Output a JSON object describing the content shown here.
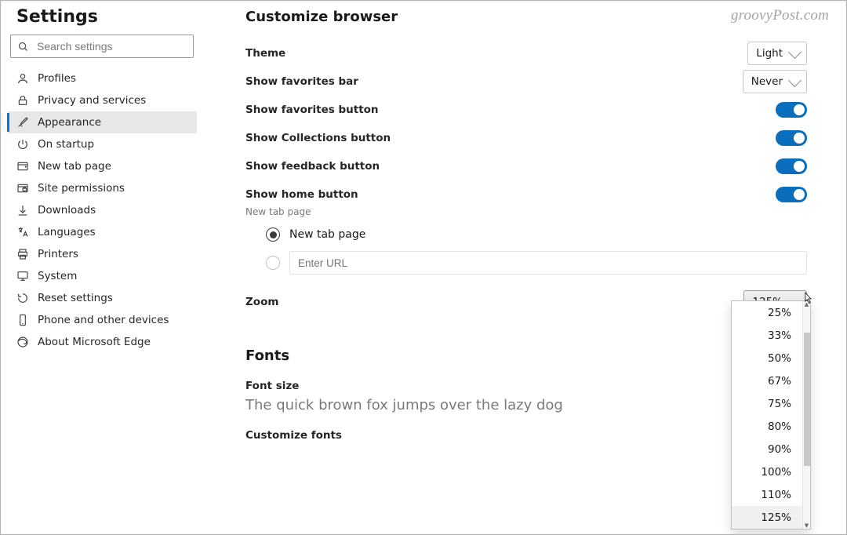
{
  "watermark": "groovyPost.com",
  "sidebar": {
    "title": "Settings",
    "search_placeholder": "Search settings",
    "items": [
      {
        "icon": "profile-icon",
        "label": "Profiles"
      },
      {
        "icon": "lock-icon",
        "label": "Privacy and services"
      },
      {
        "icon": "paint-icon",
        "label": "Appearance",
        "active": true
      },
      {
        "icon": "power-icon",
        "label": "On startup"
      },
      {
        "icon": "newtab-icon",
        "label": "New tab page"
      },
      {
        "icon": "perm-icon",
        "label": "Site permissions"
      },
      {
        "icon": "download-icon",
        "label": "Downloads"
      },
      {
        "icon": "lang-icon",
        "label": "Languages"
      },
      {
        "icon": "printer-icon",
        "label": "Printers"
      },
      {
        "icon": "system-icon",
        "label": "System"
      },
      {
        "icon": "reset-icon",
        "label": "Reset settings"
      },
      {
        "icon": "phone-icon",
        "label": "Phone and other devices"
      },
      {
        "icon": "edge-icon",
        "label": "About Microsoft Edge"
      }
    ]
  },
  "main": {
    "header": "Customize browser",
    "theme": {
      "label": "Theme",
      "value": "Light"
    },
    "favbar": {
      "label": "Show favorites bar",
      "value": "Never"
    },
    "favbtn": {
      "label": "Show favorites button",
      "on": true
    },
    "collections": {
      "label": "Show Collections button",
      "on": true
    },
    "feedback": {
      "label": "Show feedback button",
      "on": true
    },
    "homebtn": {
      "label": "Show home button",
      "on": true,
      "sublabel": "New tab page"
    },
    "home_radio": {
      "newtab_label": "New tab page",
      "url_placeholder": "Enter URL"
    },
    "zoom": {
      "label": "Zoom",
      "value": "125%"
    },
    "fonts": {
      "header": "Fonts",
      "size_label": "Font size",
      "sample": "The quick brown fox jumps over the lazy dog",
      "customize_label": "Customize fonts"
    }
  },
  "zoom_options": [
    "25%",
    "33%",
    "50%",
    "67%",
    "75%",
    "80%",
    "90%",
    "100%",
    "110%",
    "125%"
  ],
  "zoom_selected": "125%"
}
